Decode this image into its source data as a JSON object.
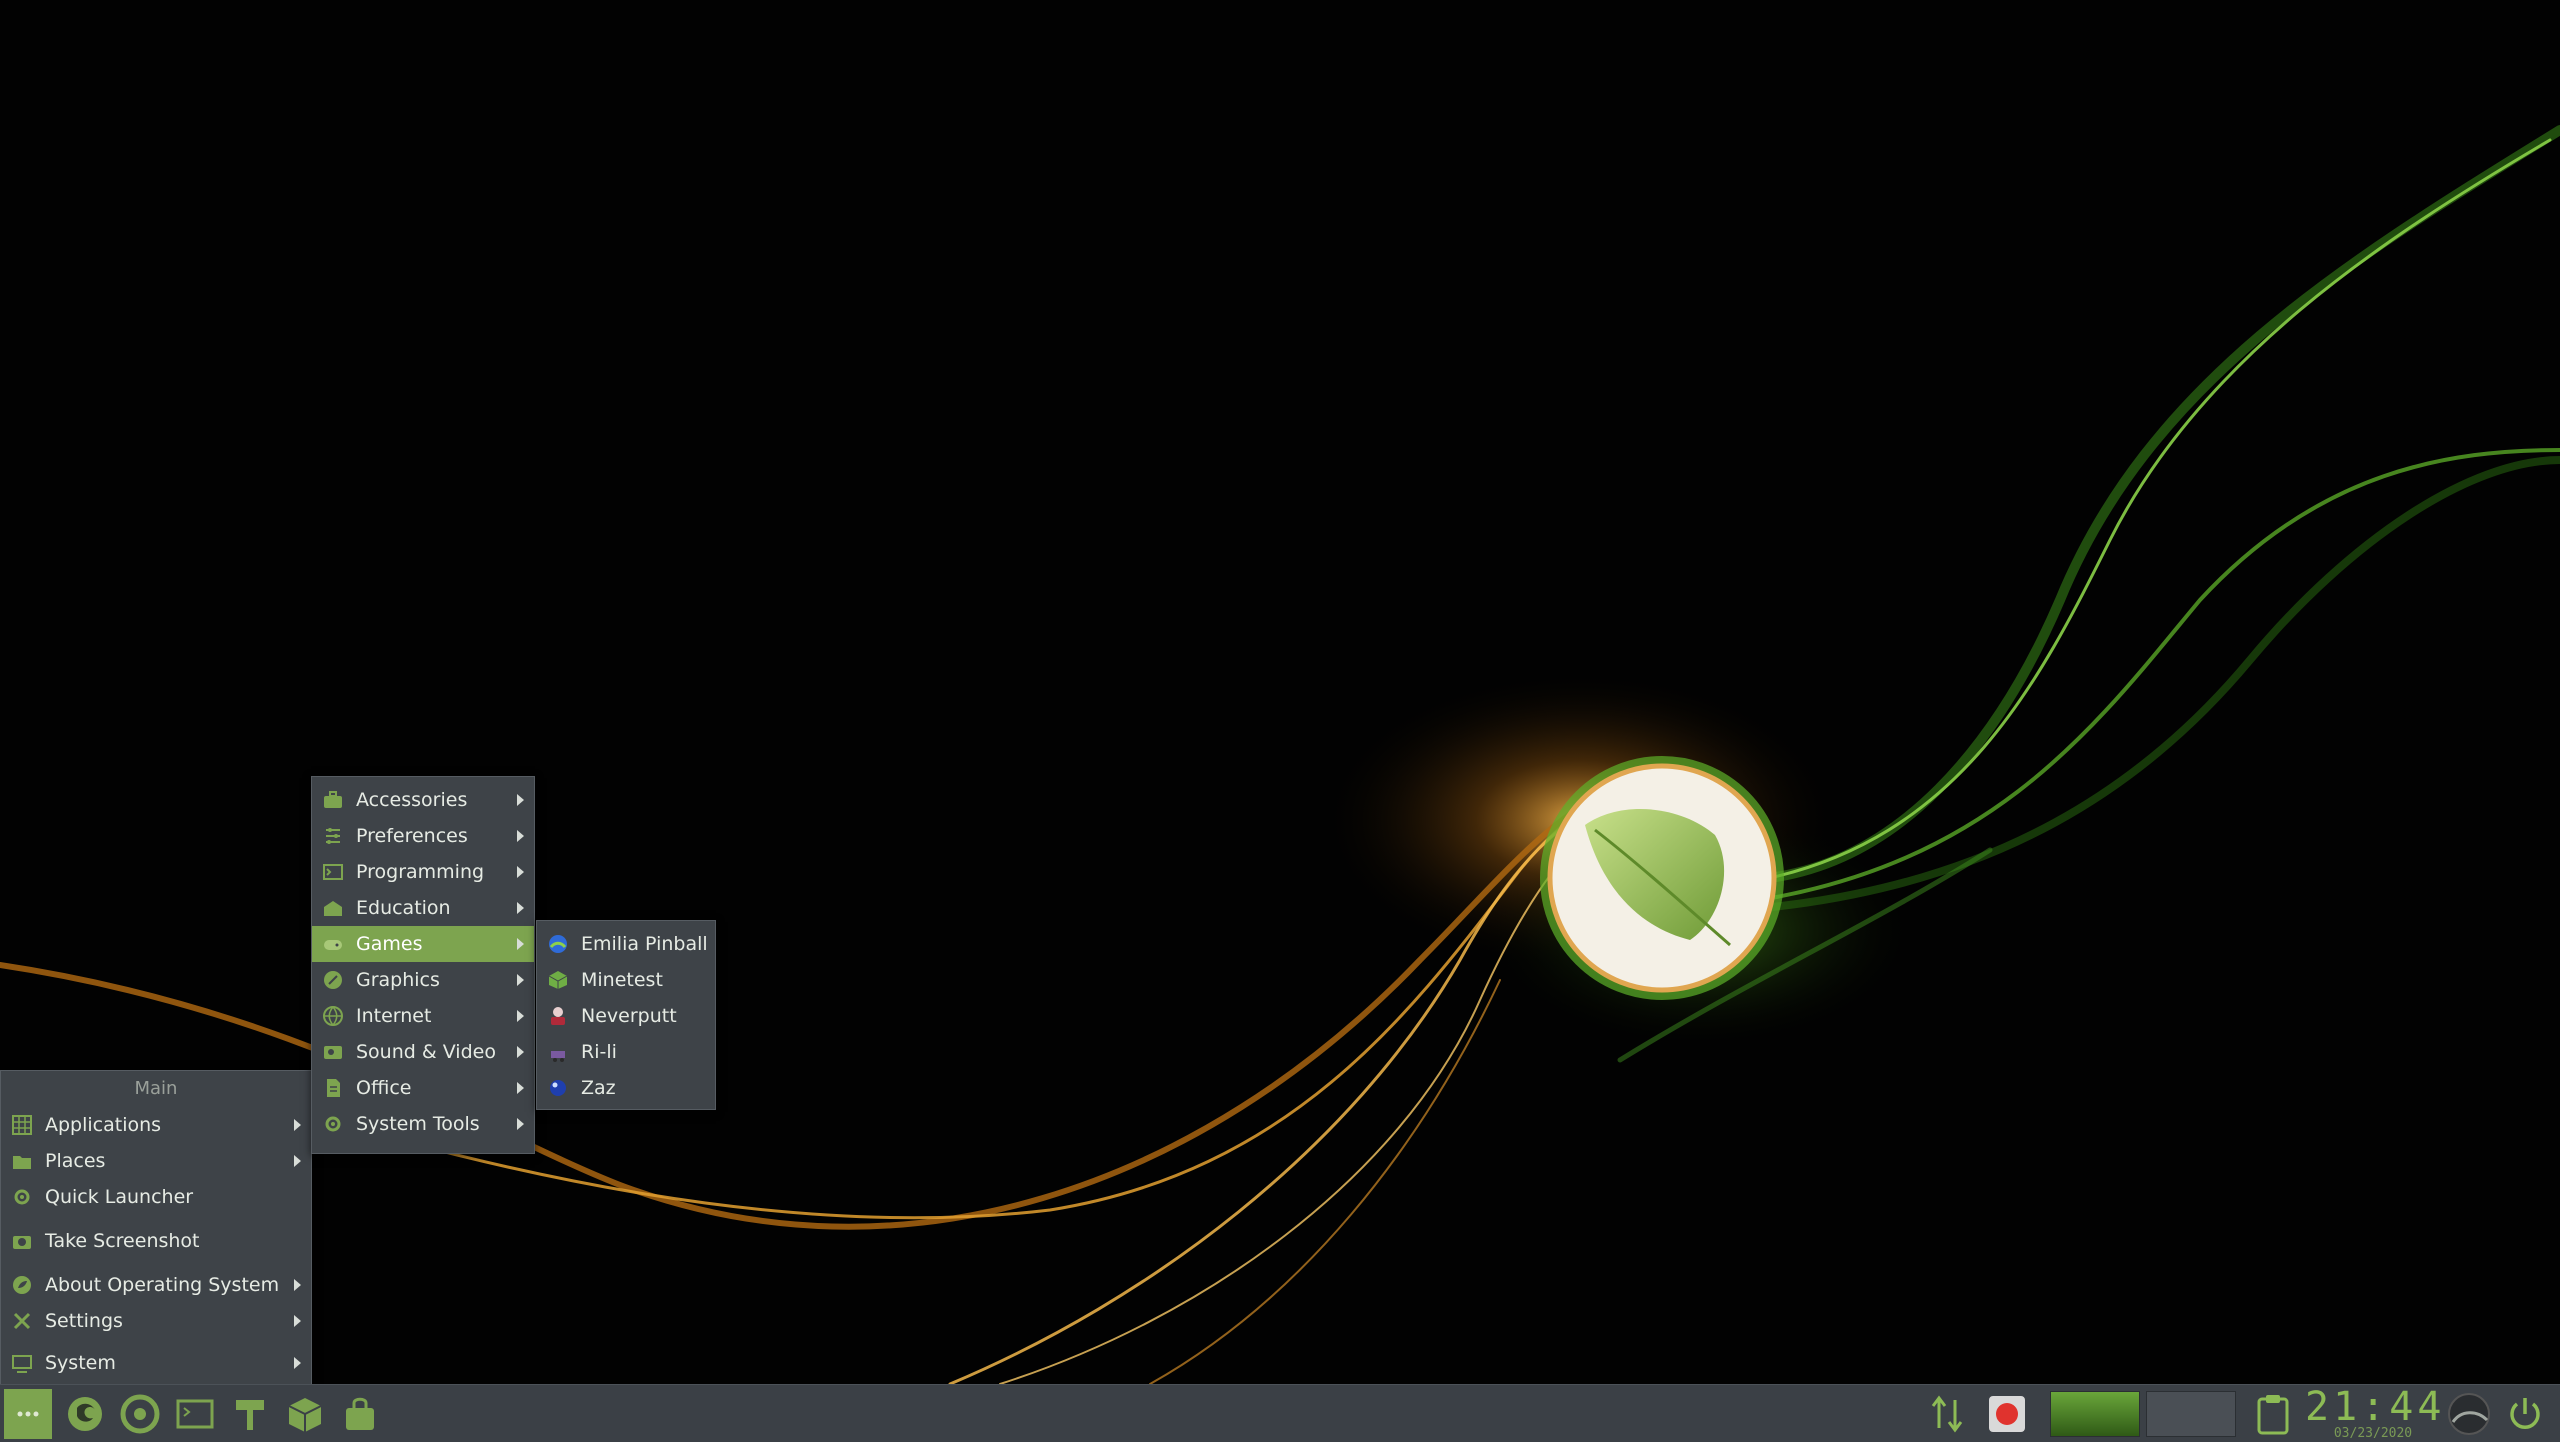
{
  "main_menu": {
    "header": "Main",
    "items": [
      {
        "label": "Applications",
        "icon": "applications-grid-icon",
        "submenu": true
      },
      {
        "label": "Places",
        "icon": "folder-icon",
        "submenu": true
      },
      {
        "label": "Quick Launcher",
        "icon": "gear-icon",
        "submenu": false
      },
      {
        "label": "Take Screenshot",
        "icon": "camera-icon",
        "submenu": false
      },
      {
        "label": "About Operating System",
        "icon": "info-leaf-icon",
        "submenu": true
      },
      {
        "label": "Settings",
        "icon": "wrench-icon",
        "submenu": true
      },
      {
        "label": "System",
        "icon": "monitor-icon",
        "submenu": true
      }
    ]
  },
  "applications_menu": {
    "items": [
      {
        "label": "Accessories",
        "icon": "briefcase-icon"
      },
      {
        "label": "Preferences",
        "icon": "sliders-icon"
      },
      {
        "label": "Programming",
        "icon": "terminal-icon"
      },
      {
        "label": "Education",
        "icon": "school-icon"
      },
      {
        "label": "Games",
        "icon": "gamepad-icon"
      },
      {
        "label": "Graphics",
        "icon": "brush-icon"
      },
      {
        "label": "Internet",
        "icon": "globe-icon"
      },
      {
        "label": "Sound & Video",
        "icon": "film-icon"
      },
      {
        "label": "Office",
        "icon": "document-icon"
      },
      {
        "label": "System Tools",
        "icon": "gear-icon"
      }
    ],
    "active": "Games"
  },
  "games_menu": {
    "items": [
      {
        "label": "Emilia Pinball",
        "icon": "pinball-icon"
      },
      {
        "label": "Minetest",
        "icon": "cube-icon"
      },
      {
        "label": "Neverputt",
        "icon": "golf-icon"
      },
      {
        "label": "Ri-li",
        "icon": "train-icon"
      },
      {
        "label": "Zaz",
        "icon": "ball-icon"
      }
    ]
  },
  "taskbar": {
    "launchers": [
      "firefox-icon",
      "chrome-icon",
      "terminal-icon",
      "hammer-icon",
      "package-icon",
      "software-store-icon"
    ],
    "clock_time": "21:44",
    "clock_date": "03/23/2020",
    "accent": "#7da44f"
  }
}
